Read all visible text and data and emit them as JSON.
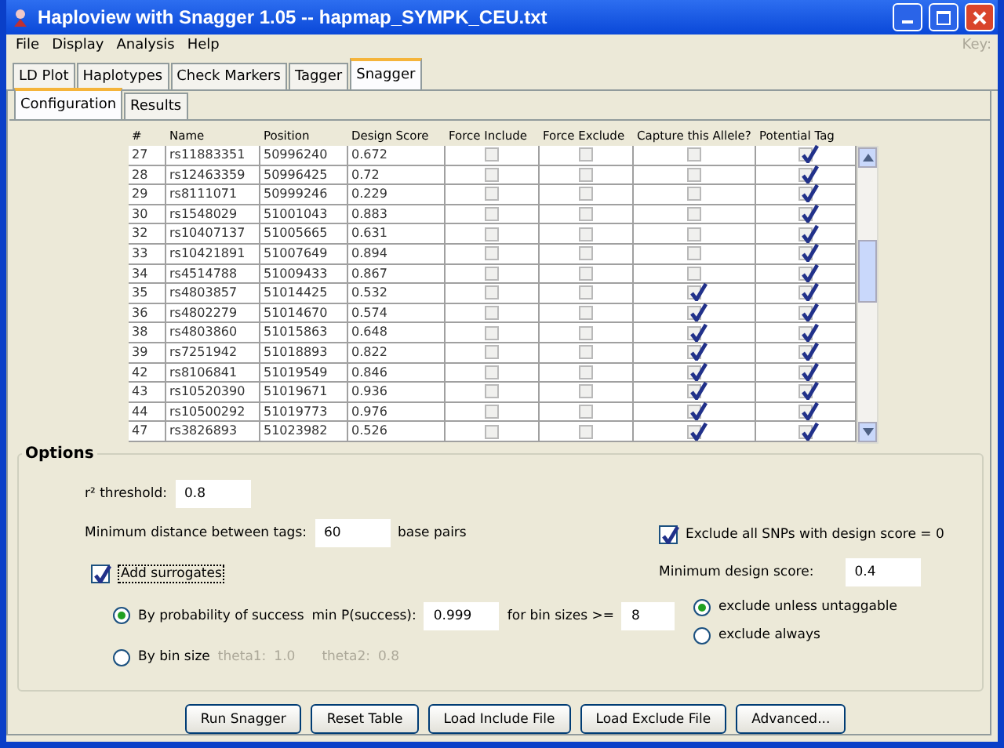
{
  "window": {
    "title": "Haploview with Snagger 1.05 -- hapmap_SYMPK_CEU.txt"
  },
  "menu": [
    {
      "label": "File"
    },
    {
      "label": "Display"
    },
    {
      "label": "Analysis"
    },
    {
      "label": "Help"
    }
  ],
  "menu_hint": {
    "label": "Key:",
    "disabled": true
  },
  "tabs": [
    {
      "label": "LD Plot",
      "selected": false
    },
    {
      "label": "Haplotypes",
      "selected": false
    },
    {
      "label": "Check Markers",
      "selected": false
    },
    {
      "label": "Tagger",
      "selected": false
    },
    {
      "label": "Snagger",
      "selected": true
    }
  ],
  "subtabs": [
    {
      "label": "Configuration",
      "selected": true
    },
    {
      "label": "Results",
      "selected": false
    }
  ],
  "table": {
    "columns": [
      "#",
      "Name",
      "Position",
      "Design Score",
      "Force Include",
      "Force Exclude",
      "Capture this Allele?",
      "Potential Tag"
    ],
    "rows": [
      {
        "cells": [
          "27",
          "rs11883351",
          "50996240",
          "0.672"
        ],
        "checks": [
          false,
          false,
          false,
          true
        ]
      },
      {
        "cells": [
          "28",
          "rs12463359",
          "50996425",
          "0.72"
        ],
        "checks": [
          false,
          false,
          false,
          true
        ]
      },
      {
        "cells": [
          "29",
          "rs8111071",
          "50999246",
          "0.229"
        ],
        "checks": [
          false,
          false,
          false,
          true
        ]
      },
      {
        "cells": [
          "30",
          "rs1548029",
          "51001043",
          "0.883"
        ],
        "checks": [
          false,
          false,
          false,
          true
        ]
      },
      {
        "cells": [
          "32",
          "rs10407137",
          "51005665",
          "0.631"
        ],
        "checks": [
          false,
          false,
          false,
          true
        ]
      },
      {
        "cells": [
          "33",
          "rs10421891",
          "51007649",
          "0.894"
        ],
        "checks": [
          false,
          false,
          false,
          true
        ]
      },
      {
        "cells": [
          "34",
          "rs4514788",
          "51009433",
          "0.867"
        ],
        "checks": [
          false,
          false,
          false,
          true
        ]
      },
      {
        "cells": [
          "35",
          "rs4803857",
          "51014425",
          "0.532"
        ],
        "checks": [
          false,
          false,
          true,
          true
        ]
      },
      {
        "cells": [
          "36",
          "rs4802279",
          "51014670",
          "0.574"
        ],
        "checks": [
          false,
          false,
          true,
          true
        ]
      },
      {
        "cells": [
          "38",
          "rs4803860",
          "51015863",
          "0.648"
        ],
        "checks": [
          false,
          false,
          true,
          true
        ]
      },
      {
        "cells": [
          "39",
          "rs7251942",
          "51018893",
          "0.822"
        ],
        "checks": [
          false,
          false,
          true,
          true
        ]
      },
      {
        "cells": [
          "42",
          "rs8106841",
          "51019549",
          "0.846"
        ],
        "checks": [
          false,
          false,
          true,
          true
        ]
      },
      {
        "cells": [
          "43",
          "rs10520390",
          "51019671",
          "0.936"
        ],
        "checks": [
          false,
          false,
          true,
          true
        ]
      },
      {
        "cells": [
          "44",
          "rs10500292",
          "51019773",
          "0.976"
        ],
        "checks": [
          false,
          false,
          true,
          true
        ]
      },
      {
        "cells": [
          "47",
          "rs3826893",
          "51023982",
          "0.526"
        ],
        "checks": [
          false,
          false,
          true,
          true
        ]
      }
    ]
  },
  "options": {
    "title": "Options",
    "r2": {
      "label": "r² threshold:",
      "value": "0.8"
    },
    "min_distance": {
      "label": "Minimum distance between tags:",
      "value": "60",
      "unit": "base pairs"
    },
    "add_surrogates": {
      "label": "Add surrogates",
      "checked": true
    },
    "by_probability": {
      "label": "By probability of success",
      "selected": true,
      "min_label": "min P(success):",
      "min_value": "0.999",
      "bin_label": "for bin sizes >=",
      "bin_value": "8"
    },
    "by_bin_size": {
      "label": "By bin size",
      "selected": false,
      "disabled": true,
      "theta1_label": "theta1:",
      "theta1_value": "1.0",
      "theta2_label": "theta2:",
      "theta2_value": "0.8"
    },
    "exclude_zero": {
      "label": "Exclude all SNPs with design score = 0",
      "checked": true
    },
    "min_design": {
      "label": "Minimum design score:",
      "value": "0.4"
    },
    "exclude_modes": [
      {
        "label": "exclude unless untaggable",
        "selected": true
      },
      {
        "label": "exclude always",
        "selected": false
      }
    ]
  },
  "buttons": [
    {
      "label": "Run Snagger"
    },
    {
      "label": "Reset Table"
    },
    {
      "label": "Load Include File"
    },
    {
      "label": "Load Exclude File"
    },
    {
      "label": "Advanced..."
    }
  ]
}
